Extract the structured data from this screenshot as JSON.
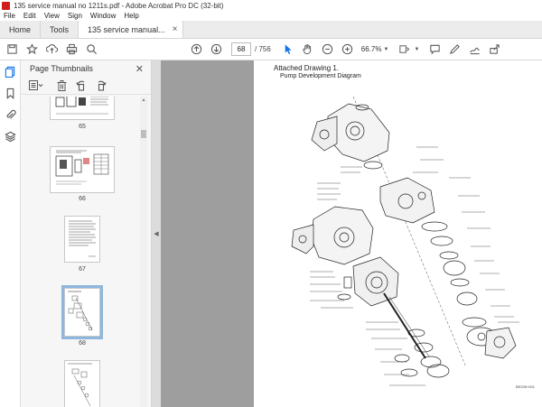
{
  "window": {
    "title": "135 service manual no 1211s.pdf - Adobe Acrobat Pro DC (32-bit)"
  },
  "menu": [
    "File",
    "Edit",
    "View",
    "Sign",
    "Window",
    "Help"
  ],
  "tabs": {
    "home": "Home",
    "tools": "Tools",
    "document": "135 service manual..."
  },
  "toolbar": {
    "icons": [
      "save-icon",
      "bookmark-star-icon",
      "upload-icon",
      "print-icon",
      "search-icon",
      "page-up-icon",
      "page-down-icon",
      "select-cursor-icon",
      "hand-icon",
      "zoom-out-icon",
      "zoom-in-icon",
      "fit-icon",
      "comment-icon",
      "pen-icon",
      "sign-icon",
      "share-icon"
    ],
    "current_page": "68",
    "page_total": "/ 756",
    "zoom": "66.7%"
  },
  "sidebar": {
    "panel_title": "Page Thumbnails",
    "thumbnails": [
      {
        "label": "65"
      },
      {
        "label": "66"
      },
      {
        "label": "67"
      },
      {
        "label": "68",
        "selected": true
      },
      {
        "label": ""
      }
    ]
  },
  "document": {
    "title": "Attached Drawing 1.",
    "subtitle": "Pump Development Diagram",
    "code": "BE335+001"
  }
}
